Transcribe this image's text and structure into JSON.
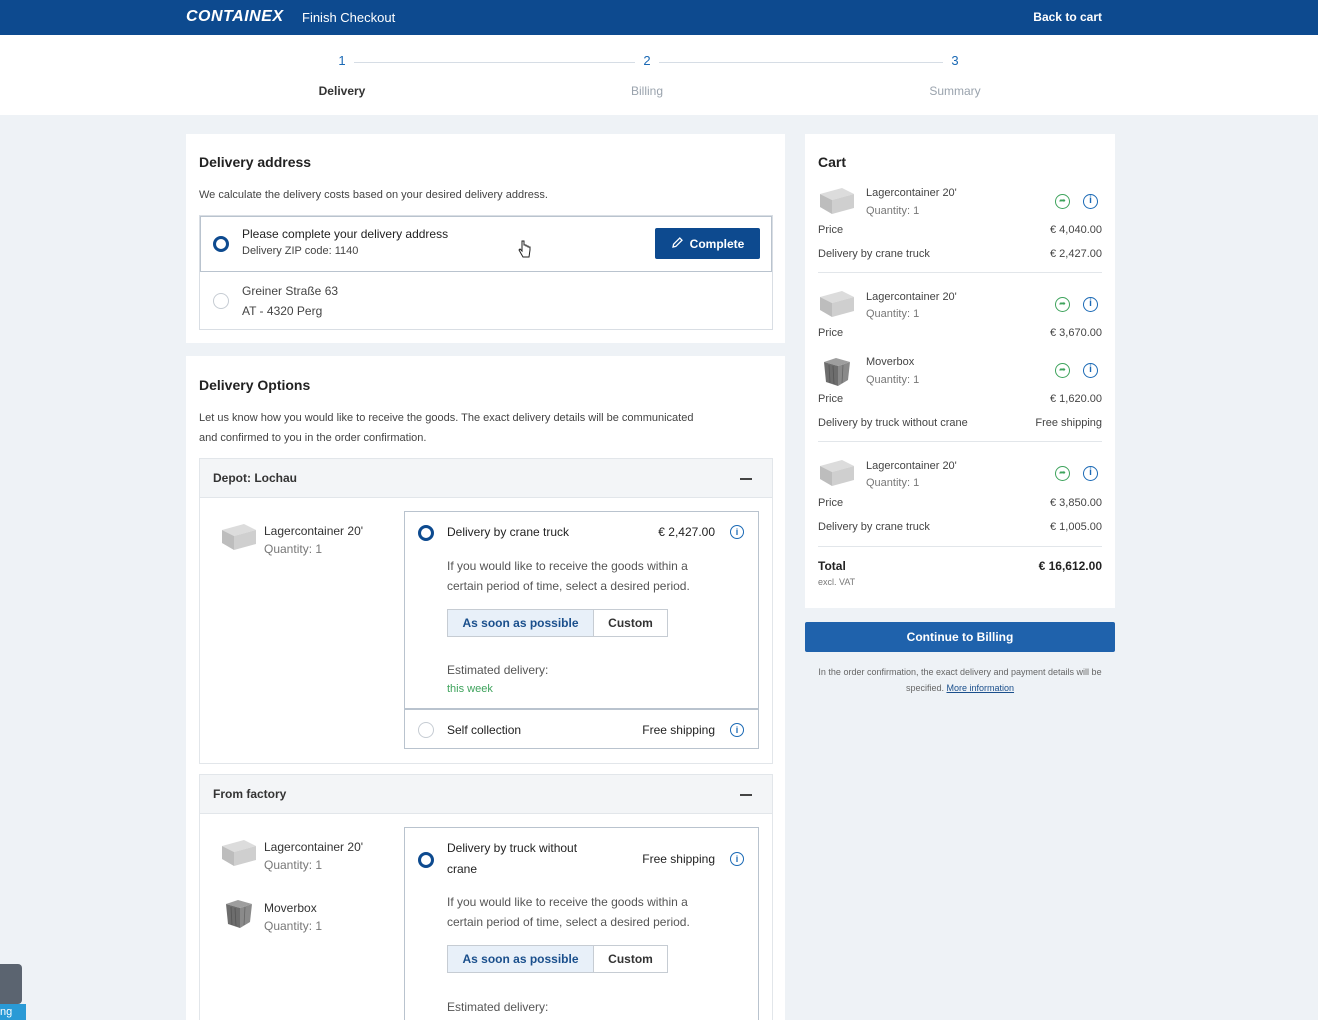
{
  "header": {
    "logo": "CONTAINEX",
    "title": "Finish Checkout",
    "back_to_cart": "Back to cart"
  },
  "steps": [
    {
      "num": "1",
      "label": "Delivery"
    },
    {
      "num": "2",
      "label": "Billing"
    },
    {
      "num": "3",
      "label": "Summary"
    }
  ],
  "delivery_address": {
    "title": "Delivery address",
    "description": "We calculate the delivery costs based on your desired delivery address.",
    "selected": {
      "line1": "Please complete your delivery address",
      "line2": "Delivery ZIP code: 1140",
      "button": "Complete"
    },
    "alternative": {
      "line1": "Greiner Straße 63",
      "line2": "AT - 4320 Perg"
    }
  },
  "delivery_options": {
    "title": "Delivery Options",
    "description_1": "Let us know how you would like to receive the goods. The exact delivery details will be communicated",
    "description_2": "and confirmed to you in the order confirmation.",
    "depot": {
      "title": "Depot: Lochau",
      "product": {
        "name": "Lagercontainer 20'",
        "qty": "Quantity: 1"
      },
      "option1": {
        "label": "Delivery by crane truck",
        "price": "€ 2,427.00",
        "hint_1": "If you would like to receive the goods within a",
        "hint_2": "certain period of time, select a desired period.",
        "seg_on": "As soon as possible",
        "seg_off": "Custom",
        "est_label": "Estimated delivery:",
        "est_value": "this week"
      },
      "option2": {
        "label": "Self collection",
        "price": "Free shipping"
      }
    },
    "factory": {
      "title": "From factory",
      "products": [
        {
          "name": "Lagercontainer 20'",
          "qty": "Quantity: 1"
        },
        {
          "name": "Moverbox",
          "qty": "Quantity: 1"
        }
      ],
      "option1": {
        "label_1": "Delivery by truck without",
        "label_2": "crane",
        "price": "Free shipping",
        "hint_1": "If you would like to receive the goods within a",
        "hint_2": "certain period of time, select a desired period.",
        "seg_on": "As soon as possible",
        "seg_off": "Custom",
        "est_label": "Estimated delivery:"
      }
    }
  },
  "cart": {
    "title": "Cart",
    "items": [
      {
        "name": "Lagercontainer 20'",
        "qty": "Quantity: 1",
        "price_label": "Price",
        "price": "€ 4,040.00",
        "delivery_label": "Delivery by crane truck",
        "delivery_price": "€ 2,427.00"
      },
      {
        "name": "Lagercontainer 20'",
        "qty": "Quantity: 1",
        "price_label": "Price",
        "price": "€ 3,670.00"
      },
      {
        "name": "Moverbox",
        "qty": "Quantity: 1",
        "price_label": "Price",
        "price": "€ 1,620.00",
        "delivery_label": "Delivery by truck without crane",
        "delivery_price": "Free shipping"
      },
      {
        "name": "Lagercontainer 20'",
        "qty": "Quantity: 1",
        "price_label": "Price",
        "price": "€ 3,850.00",
        "delivery_label": "Delivery by crane truck",
        "delivery_price": "€ 1,005.00"
      }
    ],
    "total_label": "Total",
    "total_sub": "excl. VAT",
    "total": "€ 16,612.00",
    "continue": "Continue to Billing",
    "note_1": "In the order confirmation, the exact delivery and payment details will be",
    "note_2": "specified.",
    "more_info": "More information"
  },
  "side_tab": {
    "label": "ng"
  },
  "colors": {
    "brand": "#0d4a8f",
    "accent": "#1a69b5",
    "success": "#3ea35c"
  }
}
